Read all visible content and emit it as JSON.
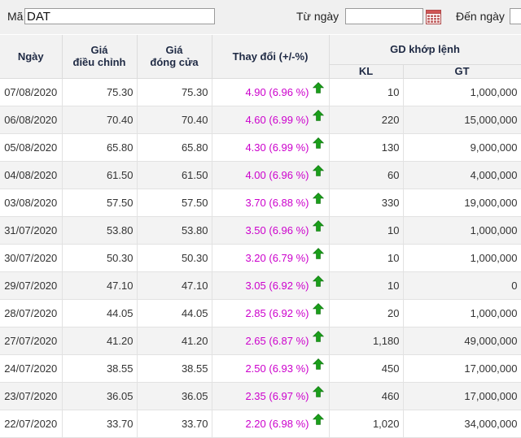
{
  "filter": {
    "code_label": "Mã",
    "code_value": "DAT",
    "from_label": "Từ ngày",
    "from_value": "",
    "to_label": "Đến ngày",
    "to_value": ""
  },
  "table": {
    "headers": {
      "date": "Ngày",
      "adjusted_line1": "Giá",
      "adjusted_line2": "điều chỉnh",
      "close_line1": "Giá",
      "close_line2": "đóng cửa",
      "change": "Thay đổi (+/-%)",
      "matched": "GD khớp lệnh",
      "volume": "KL",
      "value": "GT"
    },
    "change_icon": "green-up-arrow-icon",
    "colors": {
      "change_text": "#cc00cc",
      "arrow": "#1a9e1a"
    },
    "rows": [
      {
        "date": "07/08/2020",
        "adjusted": "75.30",
        "close": "75.30",
        "change": "4.90 (6.96 %)",
        "volume": "10",
        "value": "1,000,000"
      },
      {
        "date": "06/08/2020",
        "adjusted": "70.40",
        "close": "70.40",
        "change": "4.60 (6.99 %)",
        "volume": "220",
        "value": "15,000,000"
      },
      {
        "date": "05/08/2020",
        "adjusted": "65.80",
        "close": "65.80",
        "change": "4.30 (6.99 %)",
        "volume": "130",
        "value": "9,000,000"
      },
      {
        "date": "04/08/2020",
        "adjusted": "61.50",
        "close": "61.50",
        "change": "4.00 (6.96 %)",
        "volume": "60",
        "value": "4,000,000"
      },
      {
        "date": "03/08/2020",
        "adjusted": "57.50",
        "close": "57.50",
        "change": "3.70 (6.88 %)",
        "volume": "330",
        "value": "19,000,000"
      },
      {
        "date": "31/07/2020",
        "adjusted": "53.80",
        "close": "53.80",
        "change": "3.50 (6.96 %)",
        "volume": "10",
        "value": "1,000,000"
      },
      {
        "date": "30/07/2020",
        "adjusted": "50.30",
        "close": "50.30",
        "change": "3.20 (6.79 %)",
        "volume": "10",
        "value": "1,000,000"
      },
      {
        "date": "29/07/2020",
        "adjusted": "47.10",
        "close": "47.10",
        "change": "3.05 (6.92 %)",
        "volume": "10",
        "value": "0"
      },
      {
        "date": "28/07/2020",
        "adjusted": "44.05",
        "close": "44.05",
        "change": "2.85 (6.92 %)",
        "volume": "20",
        "value": "1,000,000"
      },
      {
        "date": "27/07/2020",
        "adjusted": "41.20",
        "close": "41.20",
        "change": "2.65 (6.87 %)",
        "volume": "1,180",
        "value": "49,000,000"
      },
      {
        "date": "24/07/2020",
        "adjusted": "38.55",
        "close": "38.55",
        "change": "2.50 (6.93 %)",
        "volume": "450",
        "value": "17,000,000"
      },
      {
        "date": "23/07/2020",
        "adjusted": "36.05",
        "close": "36.05",
        "change": "2.35 (6.97 %)",
        "volume": "460",
        "value": "17,000,000"
      },
      {
        "date": "22/07/2020",
        "adjusted": "33.70",
        "close": "33.70",
        "change": "2.20 (6.98 %)",
        "volume": "1,020",
        "value": "34,000,000"
      }
    ]
  }
}
